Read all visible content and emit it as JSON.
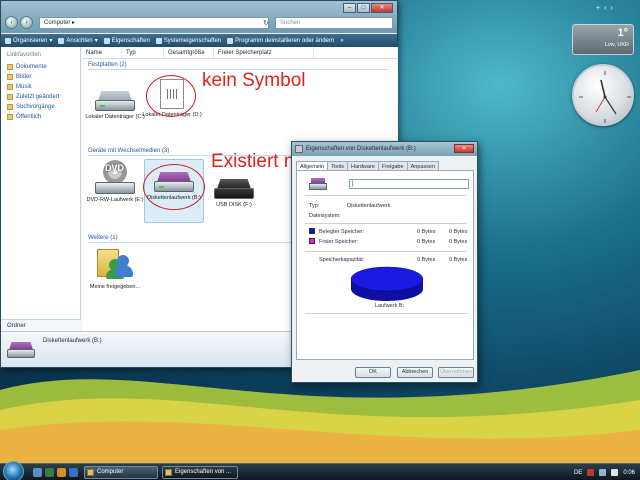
{
  "explorer": {
    "address": "Computer",
    "search_placeholder": "Suchen",
    "toolbar": [
      "Organisieren",
      "Ansichten",
      "Eigenschaften",
      "Systemeigenschaften",
      "Programm deinstallieren oder ändern"
    ],
    "toolbar_more": "»",
    "nav_heading": "Linkfavoriten",
    "nav_items": [
      "Dokumente",
      "Bilder",
      "Musik",
      "Zuletzt geändert",
      "Suchvorgänge",
      "Öffentlich"
    ],
    "folders_label": "Ordner",
    "columns": [
      "Name",
      "Typ",
      "Gesamtgröße",
      "Freier Speicherplatz"
    ],
    "groups": {
      "hdd": "Festplatten (2)",
      "removable": "Geräte mit Wechselmedien (3)",
      "other": "Weitere (1)"
    },
    "items": {
      "c": "Lokaler Datenträger (C:)",
      "d": "Lokaler Datenträger (D:)",
      "dvd": "DVD-RW-Laufwerk (E:)",
      "floppy": "Diskettenlaufwerk (B:)",
      "usb": "USB DISK (F:)",
      "share": "Meine freigegeben..."
    },
    "dvd_icon_text": "DVD",
    "details_name": "Diskettenlaufwerk (B:)"
  },
  "annotations": {
    "no_symbol": "kein Symbol",
    "not_exists": "Existiert nicht"
  },
  "dialog": {
    "title": "Eigenschaften von Diskettenlaufwerk (B:)",
    "tabs": [
      "Allgemein",
      "Tools",
      "Hardware",
      "Freigabe",
      "Anpassen"
    ],
    "type_label": "Typ:",
    "type_value": "Diskettenlaufwerk",
    "fs_label": "Dateisystem:",
    "used_label": "Belegter Speicher:",
    "used_value": "0 Bytes",
    "used_value2": "0 Bytes",
    "free_label": "Freier Speicher:",
    "free_value": "0 Bytes",
    "free_value2": "0 Bytes",
    "cap_label": "Speicherkapazität:",
    "cap_value": "0 Bytes",
    "cap_value2": "0 Bytes",
    "drive_label": "Laufwerk B:",
    "ok": "OK",
    "cancel": "Abbrechen",
    "apply": "Übernehmen",
    "colors": {
      "used": "#1010c8",
      "free": "#e020e0",
      "pie": "#1a1ae0"
    }
  },
  "weather": {
    "temp": "1°",
    "location": "Lviv, UKR"
  },
  "taskbar": {
    "tasks": [
      "Computer",
      "Eigenschaften von ..."
    ],
    "language": "DE",
    "clock": "0:06"
  }
}
